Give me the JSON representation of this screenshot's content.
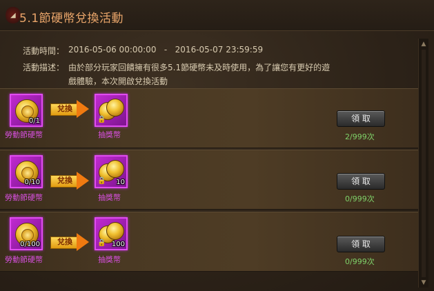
{
  "header": {
    "title": "5.1節硬幣兌換活動"
  },
  "info": {
    "time_label": "活動時間：",
    "time_value": "2016-05-06 00:00:00   -   2016-05-07 23:59:59",
    "desc_label": "活動描述：",
    "desc_line1": "由於部分玩家回饋擁有很多5.1節硬幣未及時使用，為了讓您有更好的遊",
    "desc_line2": "戲體驗，本次開啟兌換活動"
  },
  "exchange_label": "兌換",
  "claim_label": "領 取",
  "rows": [
    {
      "cost_count": "0/1",
      "cost_name": "勞動節硬幣",
      "reward_count": "",
      "reward_name": "抽獎幣",
      "times": "2/999次"
    },
    {
      "cost_count": "0/10",
      "cost_name": "勞動節硬幣",
      "reward_count": "10",
      "reward_name": "抽獎幣",
      "times": "0/999次"
    },
    {
      "cost_count": "0/100",
      "cost_name": "勞動節硬幣",
      "reward_count": "100",
      "reward_name": "抽獎幣",
      "times": "0/999次"
    }
  ],
  "colors": {
    "title": "#e9a56a",
    "item_name": "#d850e0",
    "times": "#7fd36a"
  }
}
